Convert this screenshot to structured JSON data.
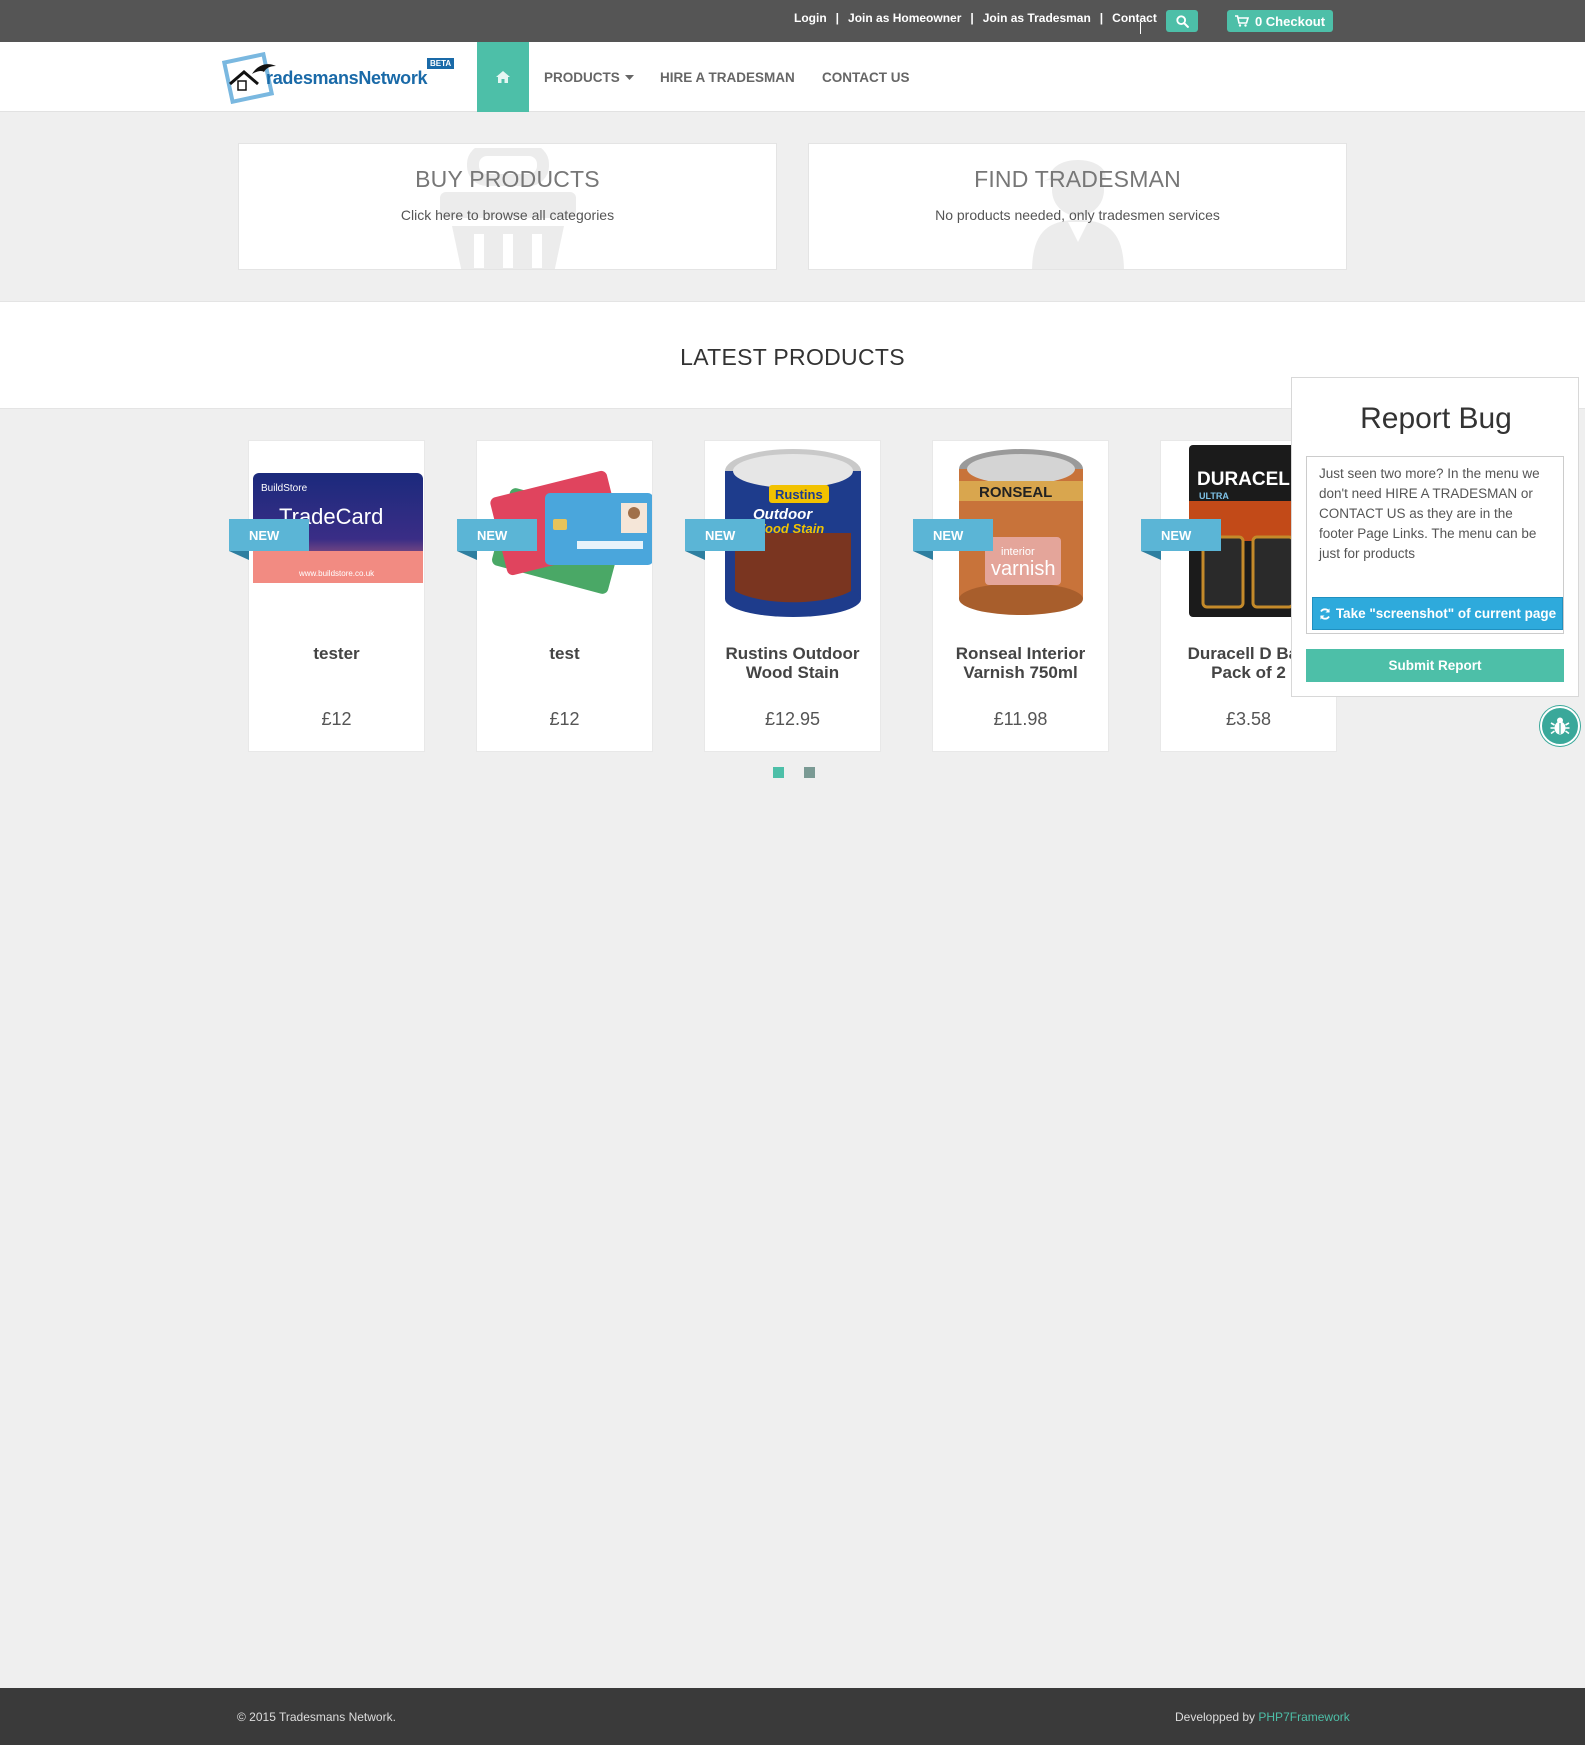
{
  "topbar": {
    "links": [
      "Login",
      "Join as Homeowner",
      "Join as Tradesman",
      "Contact"
    ],
    "separator": "|",
    "checkout": "0 Checkout"
  },
  "nav": {
    "logo_text": "radesmansNetwork",
    "logo_badge": "BETA",
    "items": [
      "PRODUCTS",
      "HIRE A TRADESMAN",
      "CONTACT US"
    ]
  },
  "hero": {
    "buy": {
      "title": "BUY PRODUCTS",
      "subtitle": "Click here to browse all categories"
    },
    "find": {
      "title": "FIND TRADESMAN",
      "subtitle": "No products needed, only tradesmen services"
    }
  },
  "latest": {
    "title": "LATEST PRODUCTS"
  },
  "products": [
    {
      "badge": "NEW",
      "name": "tester",
      "price": "£12"
    },
    {
      "badge": "NEW",
      "name": "test",
      "price": "£12"
    },
    {
      "badge": "NEW",
      "name": "Rustins Outdoor Wood Stain",
      "price": "£12.95"
    },
    {
      "badge": "NEW",
      "name": "Ronseal Interior Varnish 750ml",
      "price": "£11.98"
    },
    {
      "badge": "NEW",
      "name": "Duracell D Batt Pack of 2",
      "price": "£3.58"
    }
  ],
  "product_images": {
    "card1": {
      "brand": "BuildStore",
      "title": "TradeCard",
      "url": "www.buildstore.co.uk"
    },
    "can1": {
      "brand": "Rustins",
      "line1": "Outdoor",
      "line2": "Wood Stain"
    },
    "can2": {
      "brand": "RONSEAL",
      "line1": "interior",
      "line2": "varnish"
    },
    "batt": {
      "brand": "DURACELL",
      "line1": "ULTRA"
    }
  },
  "bug_report": {
    "title": "Report Bug",
    "message": "Just seen two more? In the menu we don't need HIRE A TRADESMAN or CONTACT US as they are in the footer Page Links. The menu can be just for products",
    "screenshot_button": "Take \"screenshot\" of current page",
    "submit_button": "Submit Report"
  },
  "footer": {
    "copyright": "© 2015 Tradesmans Network.",
    "dev_prefix": "Developped by ",
    "dev_link": "PHP7Framework"
  },
  "colors": {
    "accent": "#4dbfa8",
    "badge": "#5bb5d6",
    "topbar": "#555555",
    "footer": "#3a3a3a"
  }
}
